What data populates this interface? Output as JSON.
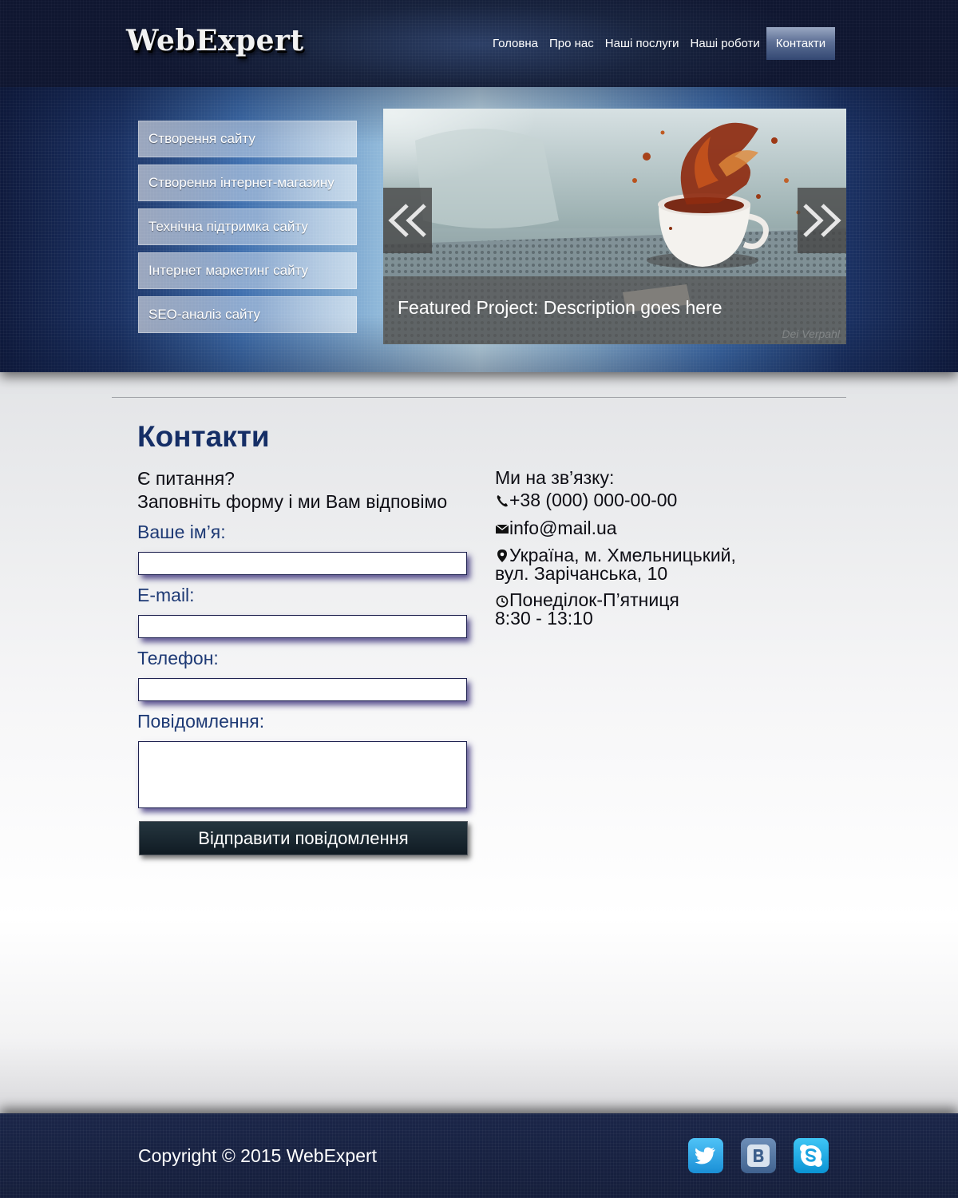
{
  "header": {
    "logo": "WebExpert",
    "nav": [
      {
        "label": "Головна"
      },
      {
        "label": "Про нас"
      },
      {
        "label": "Наші послуги"
      },
      {
        "label": "Наші роботи"
      },
      {
        "label": "Контакти",
        "active": true
      }
    ]
  },
  "services": [
    {
      "label": "Створення сайту"
    },
    {
      "label": "Створення інтернет-магазину"
    },
    {
      "label": "Технічна підтримка сайту"
    },
    {
      "label": "Інтернет маркетинг сайту"
    },
    {
      "label": "SEO-аналіз сайту"
    }
  ],
  "slider": {
    "caption": "Featured Project: Description goes here",
    "watermark": "Dei Verpahl",
    "prev_icon": "chevron-left-double-icon",
    "next_icon": "chevron-right-double-icon"
  },
  "main": {
    "title": "Контакти",
    "intro_line1": "Є питання?",
    "intro_line2": "Заповніть форму і ми Вам відповімо",
    "form": {
      "name_label": "Ваше ім’я:",
      "name_value": "",
      "email_label": "E-mail:",
      "email_value": "",
      "phone_label": "Телефон:",
      "phone_value": "",
      "message_label": "Повідомлення:",
      "message_value": "",
      "submit_label": "Відправити повідомлення"
    },
    "contacts": {
      "heading": "Ми на зв’язку:",
      "phone": "+38 (000) 000-00-00",
      "email": "info@mail.ua",
      "address_line1": "Україна, м. Хмельницький,",
      "address_line2": "вул. Зарічанська, 10",
      "hours_line1": "Понеділок-П’ятниця",
      "hours_line2": "8:30 - 13:10"
    }
  },
  "footer": {
    "copyright": "Copyright © 2015 WebExpert",
    "social": [
      {
        "icon": "twitter-icon",
        "color": "#1da1f2"
      },
      {
        "icon": "vk-icon",
        "color": "#4a76a8"
      },
      {
        "icon": "skype-icon",
        "color": "#00aff0"
      }
    ]
  },
  "colors": {
    "accent": "#152e66",
    "label": "#1e3a75",
    "header_bg": "#17223d"
  }
}
